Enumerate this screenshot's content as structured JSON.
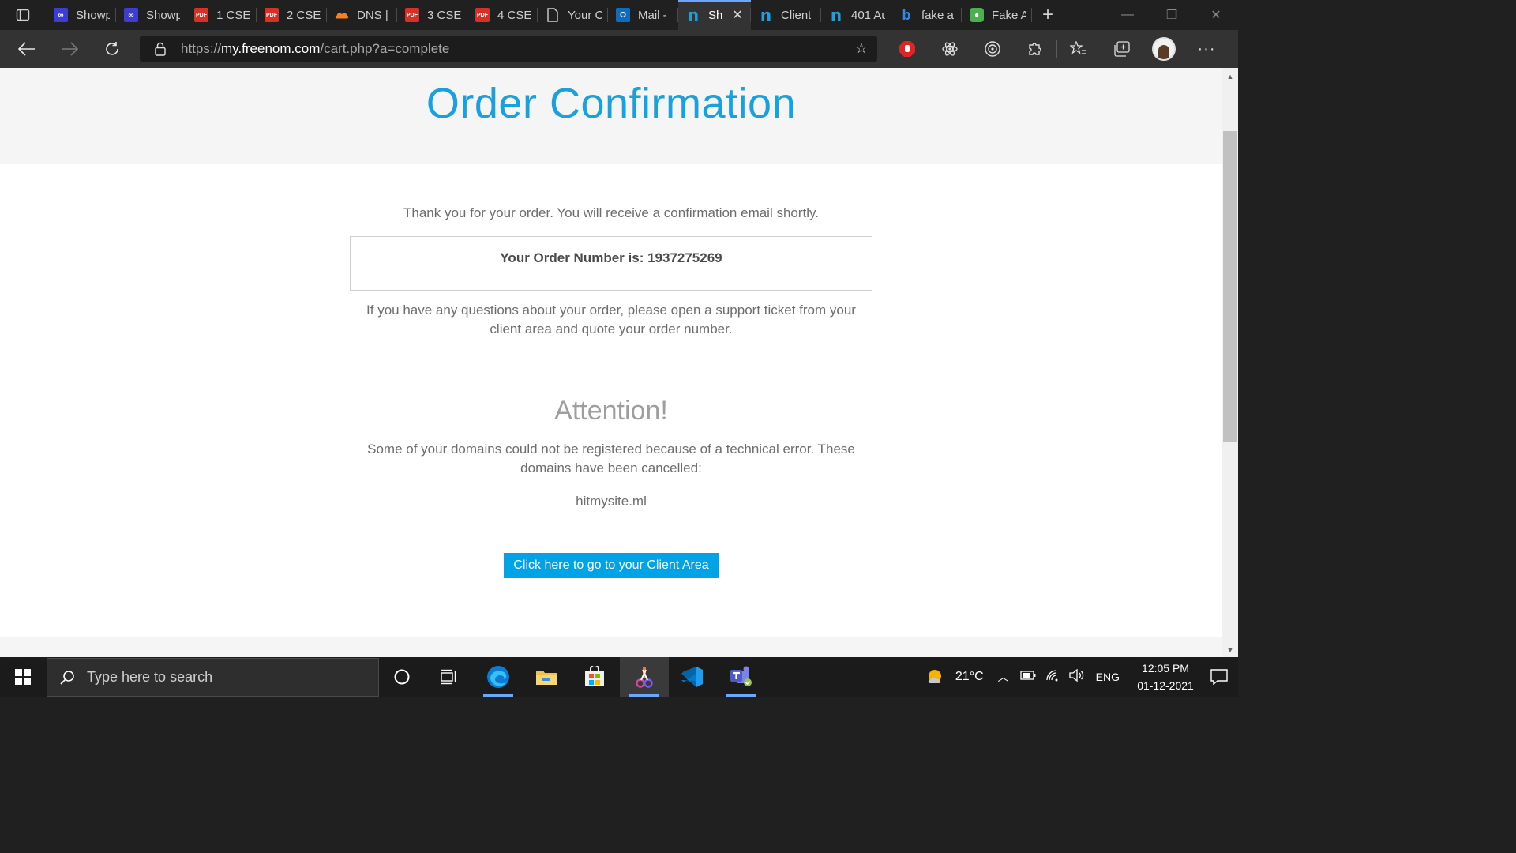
{
  "browser": {
    "tabs": [
      {
        "title": "Showp",
        "icon": "infinity-icon",
        "color": "#3d3dcf"
      },
      {
        "title": "Showp",
        "icon": "infinity-icon",
        "color": "#3d3dcf"
      },
      {
        "title": "1 CSE-",
        "icon": "pdf-icon",
        "color": "#d93025"
      },
      {
        "title": "2 CSE-",
        "icon": "pdf-icon",
        "color": "#d93025"
      },
      {
        "title": "DNS |",
        "icon": "cloudflare-icon",
        "color": "#f48120"
      },
      {
        "title": "3 CSE-",
        "icon": "pdf-icon",
        "color": "#d93025"
      },
      {
        "title": "4 CSE-",
        "icon": "pdf-icon",
        "color": "#d93025"
      },
      {
        "title": "Your C",
        "icon": "page-icon",
        "color": "#cccccc"
      },
      {
        "title": "Mail -",
        "icon": "outlook-icon",
        "color": "#0f6cbd"
      },
      {
        "title": "Sh",
        "icon": "freenom-icon",
        "color": "#1aa0dc",
        "active": true
      },
      {
        "title": "Client",
        "icon": "freenom-icon",
        "color": "#1aa0dc"
      },
      {
        "title": "401 Au",
        "icon": "freenom-icon",
        "color": "#1aa0dc"
      },
      {
        "title": "fake a",
        "icon": "bing-icon",
        "color": "#2b8cf0"
      },
      {
        "title": "Fake A",
        "icon": "map-pin-icon",
        "color": "#4caf50"
      }
    ],
    "url_prefix": "https://",
    "url_host": "my.freenom.com",
    "url_path": "/cart.php?a=complete"
  },
  "page": {
    "title": "Order Confirmation",
    "thanks": "Thank you for your order. You will receive a confirmation email shortly.",
    "order_number_label": "Your Order Number is: 1937275269",
    "questions": "If you have any questions about your order, please open a support ticket from your client area and quote your order number.",
    "attention_title": "Attention!",
    "cancel_text": "Some of your domains could not be registered because of a technical error. These domains have been cancelled:",
    "cancelled_domain": "hitmysite.ml",
    "client_area_button": "Click here to go to your Client Area",
    "accent_color": "#1aa0dc",
    "button_color": "#00a3e6"
  },
  "taskbar": {
    "search_placeholder": "Type here to search",
    "temperature": "21°C",
    "language": "ENG",
    "time": "12:05 PM",
    "date": "01-12-2021"
  }
}
